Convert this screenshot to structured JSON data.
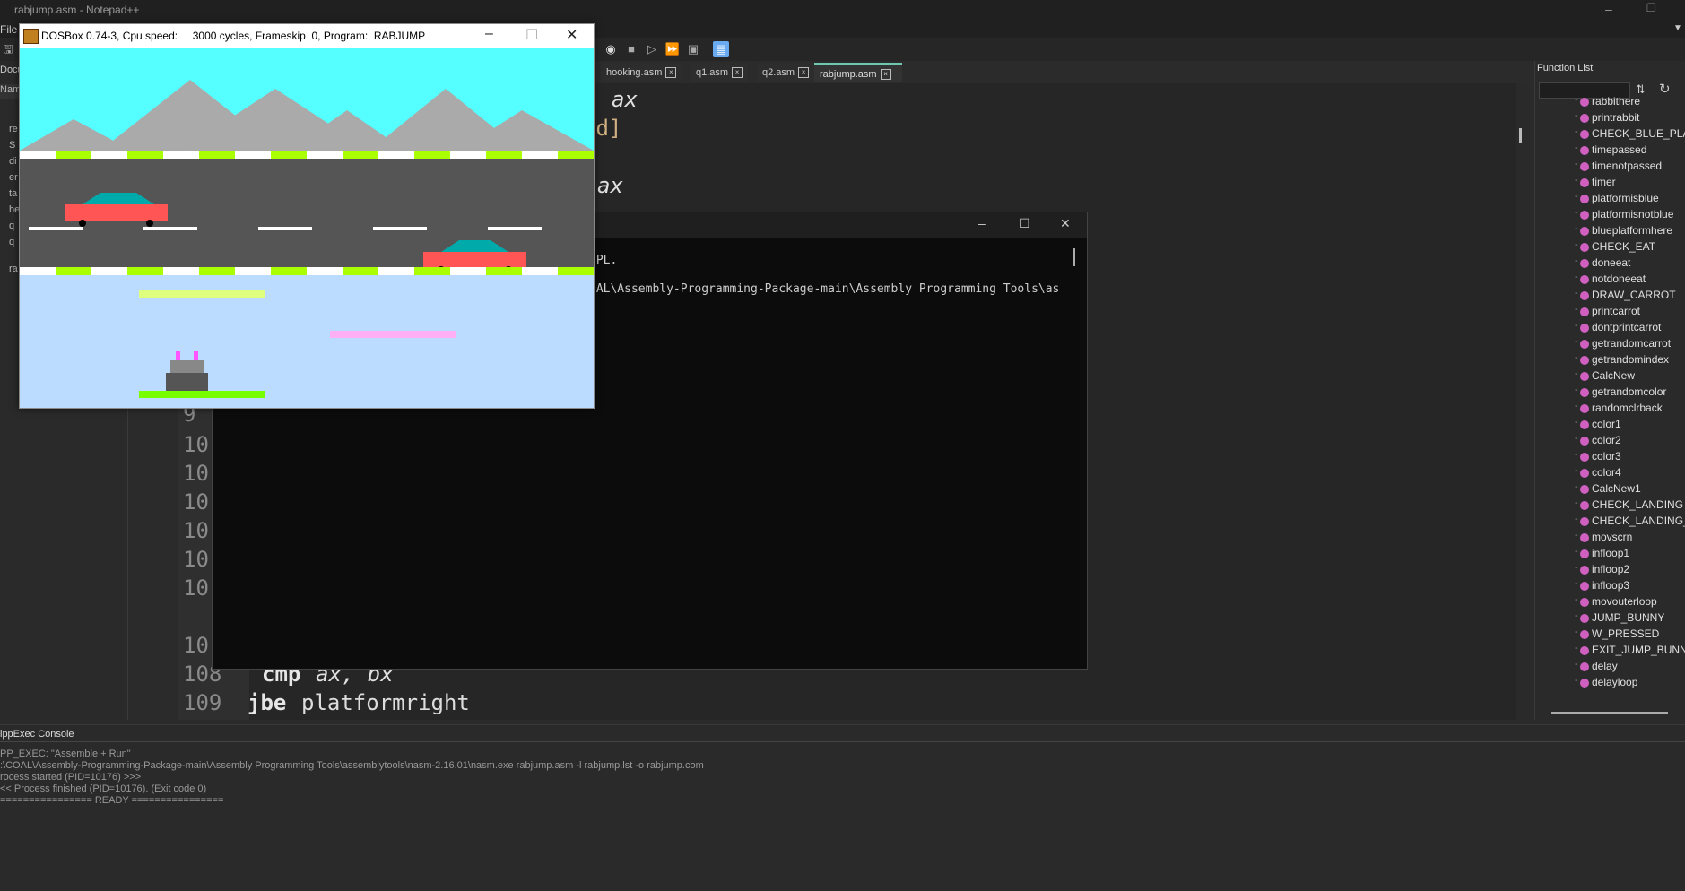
{
  "npp": {
    "title": "rabjump.asm - Notepad++",
    "menu_file": "File",
    "tabs": [
      {
        "label": "hooking.asm"
      },
      {
        "label": "q1.asm"
      },
      {
        "label": "q2.asm"
      },
      {
        "label": "rabjump.asm",
        "active": true
      }
    ],
    "doc_list": {
      "header": "Docu",
      "column": "Nam",
      "items": [
        "re",
        "S",
        "di",
        "er",
        "ta",
        "he",
        "q",
        "q",
        "ra"
      ]
    },
    "editor": {
      "line_numbers": [
        "9",
        "10",
        "10",
        "10",
        "10",
        "10",
        "10",
        "10",
        "108",
        "109"
      ],
      "code_fragments": {
        "ax1": "ax",
        "nd": "nd]",
        "ax2": "ax",
        "line108_kw": "cmp",
        "line108_args": "ax, bx",
        "line109_kw": "jbe",
        "line109_args": "platformright"
      }
    },
    "function_list": {
      "header": "Function List",
      "items": [
        "rabbithere",
        "printrabbit",
        "CHECK_BLUE_PLATF",
        "timepassed",
        "timenotpassed",
        "timer",
        "platformisblue",
        "platformisnotblue",
        "blueplatformhere",
        "CHECK_EAT",
        "doneeat",
        "notdoneeat",
        "DRAW_CARROT",
        "printcarrot",
        "dontprintcarrot",
        "getrandomcarrot",
        "getrandomindex",
        "CalcNew",
        "getrandomcolor",
        "randomclrback",
        "color1",
        "color2",
        "color3",
        "color4",
        "CalcNew1",
        "CHECK_LANDING",
        "CHECK_LANDING_n",
        "movscrn",
        "infloop1",
        "infloop2",
        "infloop3",
        "movouterloop",
        "JUMP_BUNNY",
        "W_PRESSED",
        "EXIT_JUMP_BUNNY",
        "delay",
        "delayloop"
      ]
    },
    "console": {
      "header": "lppExec Console",
      "lines": [
        "PP_EXEC: \"Assemble + Run\"",
        ":\\COAL\\Assembly-Programming-Package-main\\Assembly Programming Tools\\assemblytools\\nasm-2.16.01\\nasm.exe rabjump.asm -l rabjump.lst -o rabjump.com",
        "rocess started (PID=10176) >>>",
        "<< Process finished (PID=10176). (Exit code 0)",
        "================ READY ================"
      ]
    }
  },
  "cmd": {
    "line1": "GPL.",
    "line2": "OAL\\Assembly-Programming-Package-main\\Assembly Programming Tools\\as"
  },
  "dosbox": {
    "title": "DOSBox 0.74-3, Cpu speed:     3000 cycles, Frameskip  0, Program:  RABJUMP",
    "colors": {
      "sky": "#55ffff",
      "mountain": "#aaaaaa",
      "road": "#555555",
      "water": "#bbdcff",
      "car_body": "#ff5555",
      "car_top": "#00aaaa",
      "stripe_green": "#aaff00",
      "platform_yellow": "#dfff7f",
      "platform_pink": "#ffb0f5",
      "platform_green": "#77ff00"
    }
  }
}
